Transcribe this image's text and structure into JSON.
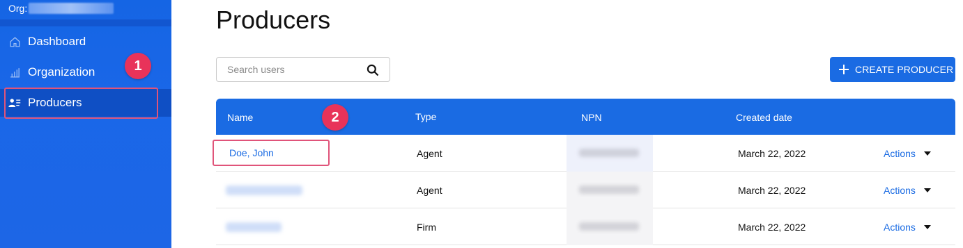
{
  "sidebar": {
    "org_label": "Org:",
    "items": [
      {
        "label": "Dashboard",
        "icon": "home-icon"
      },
      {
        "label": "Organization",
        "icon": "bar-chart-icon"
      },
      {
        "label": "Producers",
        "icon": "users-list-icon"
      }
    ]
  },
  "annotations": {
    "badge1": "1",
    "badge2": "2"
  },
  "main": {
    "title": "Producers",
    "search": {
      "placeholder": "Search users"
    },
    "create_button": "CREATE PRODUCER",
    "table": {
      "columns": [
        "Name",
        "Type",
        "NPN",
        "Created date"
      ],
      "rows": [
        {
          "name": "Doe, John",
          "type": "Agent",
          "created": "March 22, 2022",
          "actions": "Actions"
        },
        {
          "name": "",
          "type": "Agent",
          "created": "March 22, 2022",
          "actions": "Actions"
        },
        {
          "name": "",
          "type": "Firm",
          "created": "March 22, 2022",
          "actions": "Actions"
        }
      ]
    }
  },
  "colors": {
    "primary": "#1a6be3",
    "badge": "#e8335a",
    "highlight": "#e0547a"
  }
}
